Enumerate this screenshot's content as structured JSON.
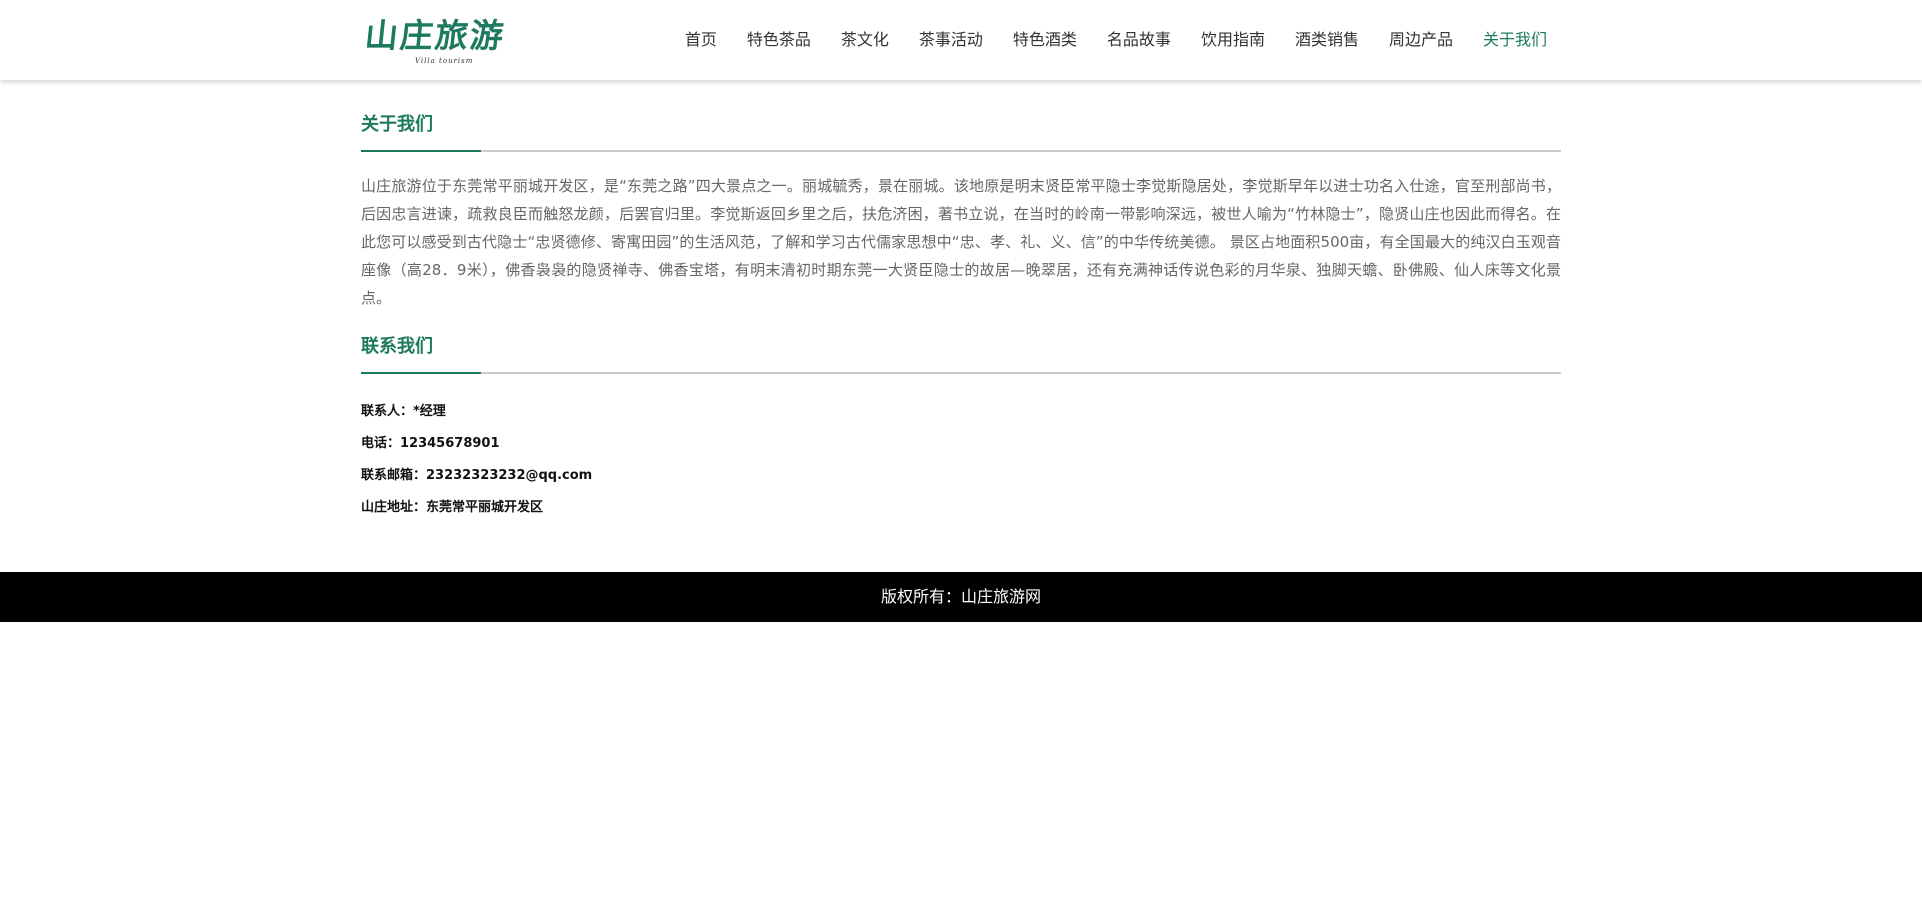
{
  "header": {
    "logo_title": "山庄旅游",
    "logo_subtitle": "Villa tourism",
    "nav": [
      {
        "label": "首页"
      },
      {
        "label": "特色茶品"
      },
      {
        "label": "茶文化"
      },
      {
        "label": "茶事活动"
      },
      {
        "label": "特色酒类"
      },
      {
        "label": "名品故事"
      },
      {
        "label": "饮用指南"
      },
      {
        "label": "酒类销售"
      },
      {
        "label": "周边产品"
      },
      {
        "label": "关于我们"
      }
    ],
    "active_nav": "关于我们"
  },
  "about": {
    "title": "关于我们",
    "text": "山庄旅游位于东莞常平丽城开发区，是“东莞之路”四大景点之一。丽城毓秀，景在丽城。该地原是明末贤臣常平隐士李觉斯隐居处，李觉斯早年以进士功名入仕途，官至刑部尚书，后因忠言进谏，疏救良臣而触怒龙颜，后罢官归里。李觉斯返回乡里之后，扶危济困，著书立说，在当时的岭南一带影响深远，被世人喻为“竹林隐士”，隐贤山庄也因此而得名。在此您可以感受到古代隐士“忠贤德修、寄寓田园”的生活风范，了解和学习古代儒家思想中“忠、孝、礼、义、信”的中华传统美德。 景区占地面积500亩，有全国最大的纯汉白玉观音座像（高28．9米），佛香袅袅的隐贤禅寺、佛香宝塔，有明末清初时期东莞一大贤臣隐士的故居—晚翠居，还有充满神话传说色彩的月华泉、独脚天蟾、卧佛殿、仙人床等文化景点。"
  },
  "contact": {
    "title": "联系我们",
    "rows": [
      {
        "text": "联系人：*经理"
      },
      {
        "text": "电话：12345678901"
      },
      {
        "text": "联系邮箱：23232323232@qq.com"
      },
      {
        "text": "山庄地址：东莞常平丽城开发区"
      }
    ]
  },
  "footer": {
    "text": "版权所有：山庄旅游网"
  },
  "colors": {
    "brand": "#1e7a5e",
    "footer_bg": "#000000",
    "rule": "#cccccc"
  }
}
